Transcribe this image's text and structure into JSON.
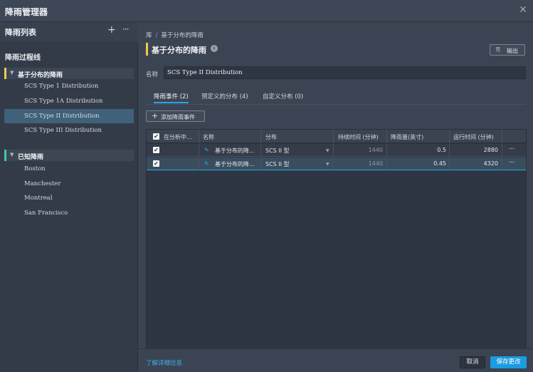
{
  "window": {
    "title": "降雨管理器",
    "close_icon": "close-icon"
  },
  "sidebar": {
    "header": "降雨列表",
    "add_icon": "+",
    "more_icon": "···",
    "section_title": "降雨过程线",
    "groups": [
      {
        "label": "基于分布的降雨",
        "color": "#f2c94c",
        "items": [
          "SCS Type 1 Distribution",
          "SCS Type 1A Distribution",
          "SCS Type II Distribution",
          "SCS Type III Distribution"
        ]
      },
      {
        "label": "已知降雨",
        "color": "#3ec9a0",
        "items": [
          "Boston",
          "Manchester",
          "Montreal",
          "San Francisco"
        ]
      }
    ],
    "active_item": "SCS Type II Distribution"
  },
  "main": {
    "breadcrumb": {
      "root": "库",
      "sep": "/",
      "current": "基于分布的降雨"
    },
    "title": "基于分布的降雨",
    "info_icon": "i",
    "export": {
      "icon": "⎘",
      "label": "输出"
    },
    "name_label": "名称",
    "name_value": "SCS Type II Distribution",
    "tabs": [
      {
        "label": "降雨事件 (2)",
        "active": true
      },
      {
        "label": "预定义的分布 (4)",
        "active": false
      },
      {
        "label": "自定义分布 (0)",
        "active": false
      }
    ],
    "add_button": {
      "icon": "+",
      "label": "添加降雨事件"
    },
    "grid": {
      "columns": [
        "在分析中...",
        "名称",
        "分布",
        "持续时间 (分钟)",
        "降雨量(英寸)",
        "运行时间 (分钟)"
      ],
      "rows": [
        {
          "checked": "✔",
          "name": "基于分布的降...",
          "distribution": "SCS II 型",
          "duration": "1440",
          "rainfall": "0.5",
          "runtime": "2880",
          "more": "···"
        },
        {
          "checked": "✔",
          "name": "基于分布的降...",
          "distribution": "SCS II 型",
          "duration": "1440",
          "rainfall": "0.45",
          "runtime": "4320",
          "more": "···"
        }
      ],
      "header_checked": "✔"
    }
  },
  "footer": {
    "learn_more": "了解详细信息",
    "cancel": "取消",
    "save": "保存更改"
  }
}
